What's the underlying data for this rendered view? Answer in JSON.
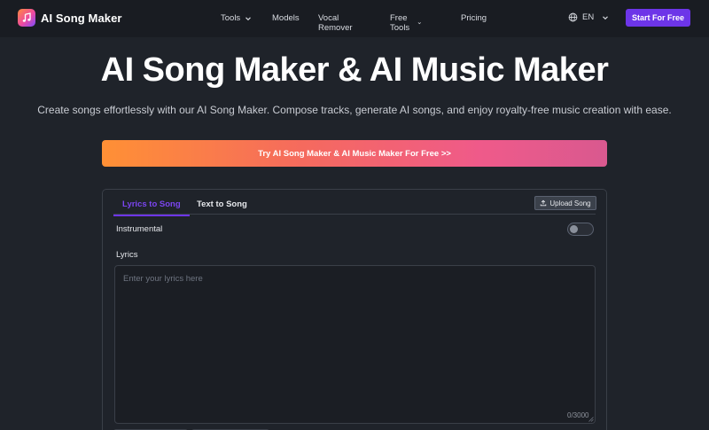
{
  "nav": {
    "brand": "AI Song Maker",
    "links": [
      {
        "label": "Tools",
        "has_dropdown": true
      },
      {
        "label": "Models",
        "has_dropdown": false
      },
      {
        "label": "Vocal Remover",
        "has_dropdown": false
      },
      {
        "label": "Free Tools",
        "has_dropdown": true
      },
      {
        "label": "Pricing",
        "has_dropdown": false
      }
    ],
    "language": "EN",
    "start_label": "Start For Free"
  },
  "hero": {
    "title": "AI Song Maker & AI Music Maker",
    "subtitle": "Create songs effortlessly with our AI Song Maker. Compose tracks, generate AI songs, and enjoy royalty-free music creation with ease.",
    "cta_label": "Try AI Song Maker & AI Music Maker For Free >>"
  },
  "panel": {
    "tabs": [
      {
        "label": "Lyrics to Song",
        "active": true
      },
      {
        "label": "Text to Song",
        "active": false
      }
    ],
    "upload_label": "Upload Song",
    "instrumental_label": "Instrumental",
    "instrumental_on": false,
    "lyrics_label": "Lyrics",
    "lyrics_placeholder": "Enter your lyrics here",
    "lyrics_value": "",
    "counter": "0/3000"
  },
  "colors": {
    "background": "#1f232a",
    "nav_background": "#191c22",
    "accent": "#6d35e8",
    "active_tab": "#7b45f0",
    "cta_gradient_start": "#ff9035",
    "cta_gradient_end": "#d9598f"
  },
  "icons": {
    "logo": "music-note-icon",
    "dropdown": "chevron-down-icon",
    "language": "globe-icon",
    "upload": "upload-icon"
  }
}
